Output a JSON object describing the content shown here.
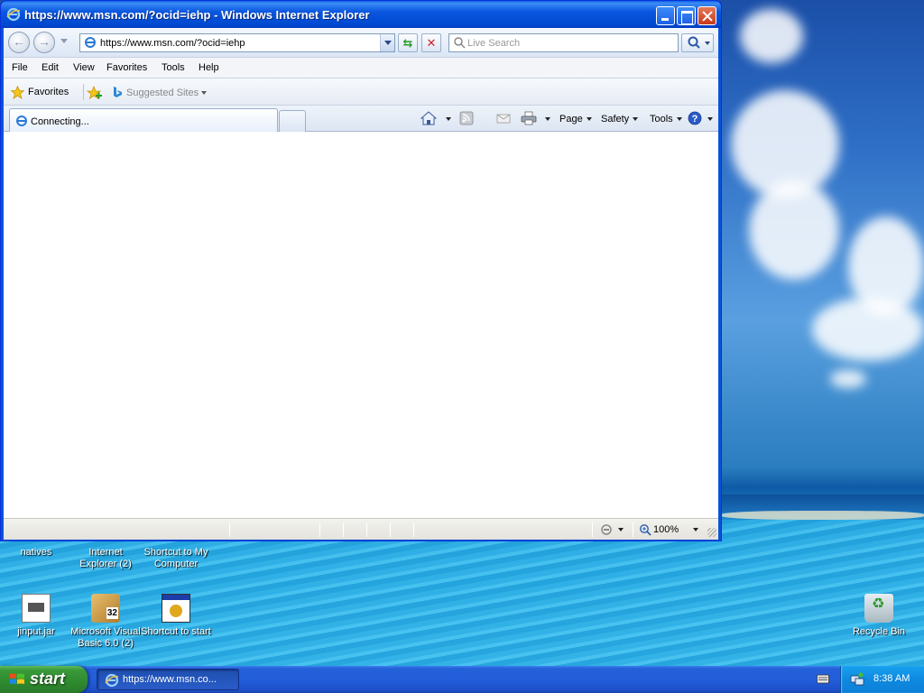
{
  "window": {
    "title": "https://www.msn.com/?ocid=iehp - Windows Internet Explorer"
  },
  "address": {
    "value": "https://www.msn.com/?ocid=iehp"
  },
  "search": {
    "placeholder": "Live Search"
  },
  "menu": {
    "items": [
      "File",
      "Edit",
      "View",
      "Favorites",
      "Tools",
      "Help"
    ]
  },
  "favorites_bar": {
    "favorites_label": "Favorites",
    "suggested_label": "Suggested Sites"
  },
  "tabs": {
    "active_label": "Connecting..."
  },
  "commands": {
    "page": "Page",
    "safety": "Safety",
    "tools": "Tools"
  },
  "status_bar": {
    "zoom": "100%"
  },
  "desktop_icons": [
    {
      "label": "natives"
    },
    {
      "label": "Internet Explorer (2)"
    },
    {
      "label": "Shortcut to My Computer"
    },
    {
      "label": "jinput.jar"
    },
    {
      "label": "Microsoft Visual Basic 6.0 (2)"
    },
    {
      "label": "Shortcut to start"
    },
    {
      "label": "Recycle Bin"
    }
  ],
  "taskbar": {
    "start_label": "start",
    "task_ie_label": "https://www.msn.co...",
    "clock": "8:38 AM"
  },
  "colors": {
    "title_bar": "#0a57e0",
    "taskbar": "#245edb",
    "start_button": "#3a9a3a"
  }
}
